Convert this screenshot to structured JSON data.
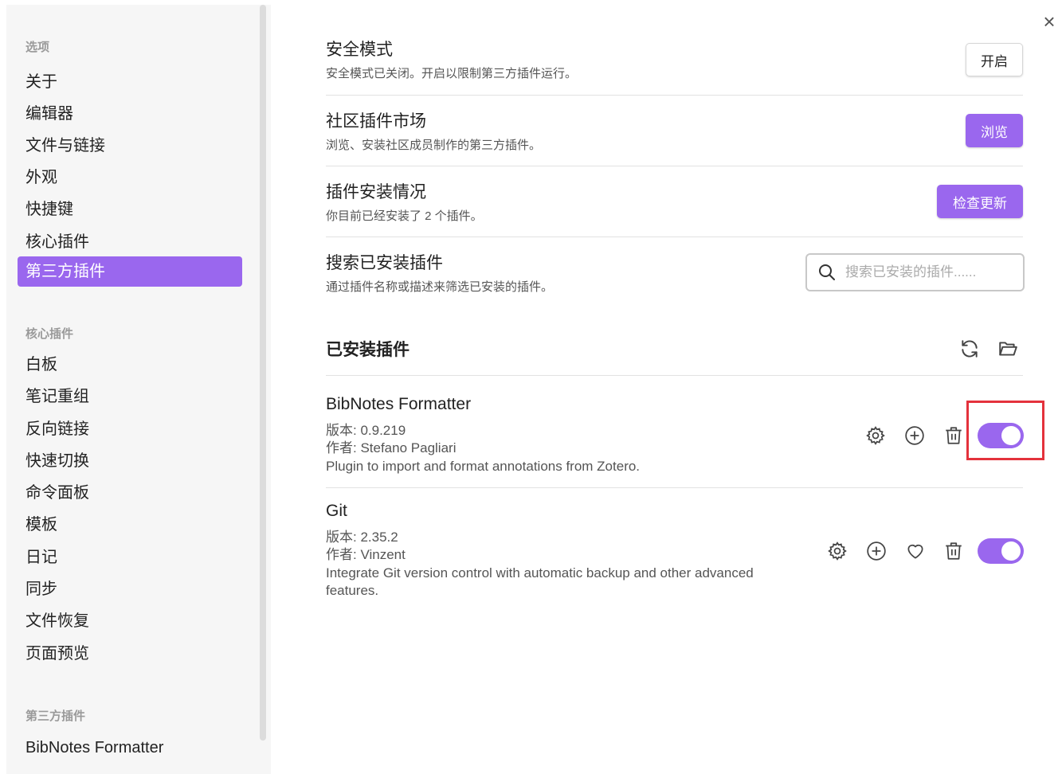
{
  "sidebar": {
    "options_heading": "选项",
    "options": [
      "关于",
      "编辑器",
      "文件与链接",
      "外观",
      "快捷键",
      "核心插件",
      "第三方插件"
    ],
    "core_heading": "核心插件",
    "core": [
      "白板",
      "笔记重组",
      "反向链接",
      "快速切换",
      "命令面板",
      "模板",
      "日记",
      "同步",
      "文件恢复",
      "页面预览"
    ],
    "third_heading": "第三方插件",
    "third": [
      "BibNotes Formatter"
    ]
  },
  "close_icon": "×",
  "settings": {
    "safe_mode": {
      "title": "安全模式",
      "desc": "安全模式已关闭。开启以限制第三方插件运行。",
      "button": "开启"
    },
    "community": {
      "title": "社区插件市场",
      "desc": "浏览、安装社区成员制作的第三方插件。",
      "button": "浏览"
    },
    "installed_status": {
      "title": "插件安装情况",
      "desc": "你目前已经安装了 2 个插件。",
      "button": "检查更新"
    },
    "search": {
      "title": "搜索已安装插件",
      "desc": "通过插件名称或描述来筛选已安装的插件。",
      "placeholder": "搜索已安装的插件......"
    }
  },
  "installed": {
    "title": "已安装插件",
    "plugins": [
      {
        "name": "BibNotes Formatter",
        "version": "版本: 0.9.219",
        "author": "作者:  Stefano Pagliari",
        "desc": "Plugin to import and format annotations from Zotero.",
        "enabled": true
      },
      {
        "name": "Git",
        "version": "版本: 2.35.2",
        "author": "作者:  Vinzent",
        "desc": "Integrate Git version control with automatic backup and other advanced features.",
        "enabled": true
      }
    ]
  },
  "colors": {
    "accent": "#9a67ee",
    "highlight": "#e4323c"
  }
}
